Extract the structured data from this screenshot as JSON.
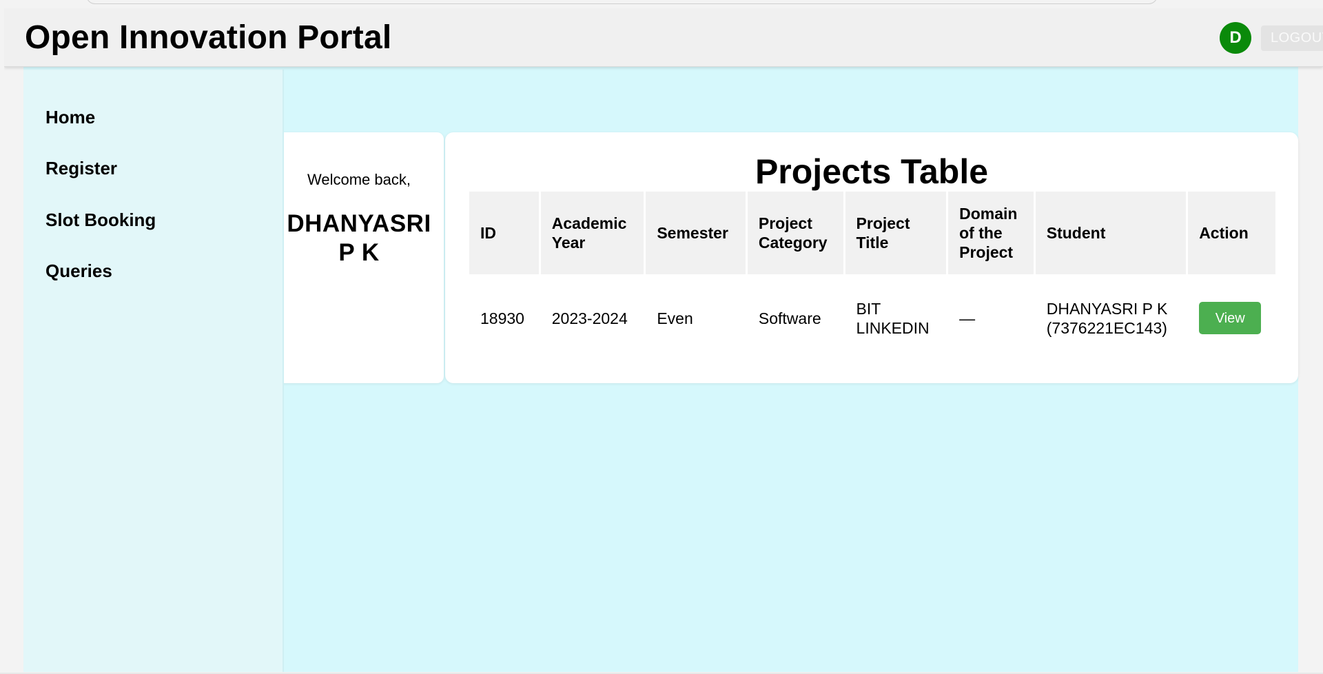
{
  "header": {
    "title": "Open Innovation Portal",
    "avatar_initial": "D",
    "logout_label": "LOGOUT"
  },
  "sidebar": {
    "items": [
      {
        "label": "Home"
      },
      {
        "label": "Register"
      },
      {
        "label": "Slot Booking"
      },
      {
        "label": "Queries"
      }
    ]
  },
  "welcome": {
    "greeting": "Welcome back,",
    "name": "DHANYASRI\nP K"
  },
  "projects": {
    "title": "Projects Table",
    "columns": [
      "ID",
      "Academic Year",
      "Semester",
      "Project Category",
      "Project Title",
      "Domain of the Project",
      "Student",
      "Action"
    ],
    "rows": [
      {
        "id": "18930",
        "academic_year": "2023-2024",
        "semester": "Even",
        "category": "Software",
        "title": "BIT LINKEDIN",
        "domain": "—",
        "student": "DHANYASRI P K (7376221EC143)",
        "action_label": "View"
      }
    ]
  },
  "colors": {
    "main_background": "#d6f8fc",
    "sidebar_background": "#e2f7f9",
    "avatar": "#0a8a0a",
    "view_button": "#4caf50"
  }
}
